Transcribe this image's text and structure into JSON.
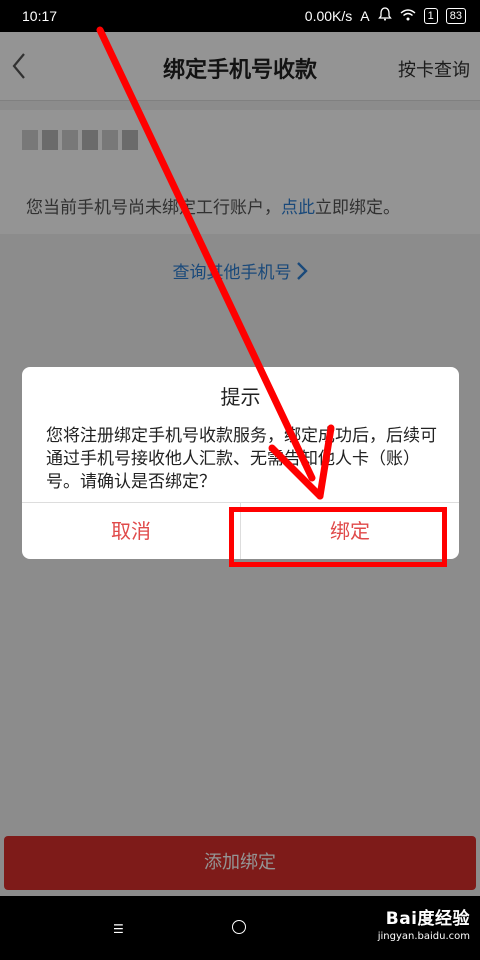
{
  "status_bar": {
    "time": "10:17",
    "network_speed": "0.00K/s",
    "sim": "1",
    "battery": "83"
  },
  "header": {
    "title": "绑定手机号收款",
    "right_link": "按卡查询"
  },
  "content": {
    "notice_prefix": "您当前手机号尚未绑定工行账户，",
    "notice_link": "点此",
    "notice_suffix": "立即绑定。",
    "query_other": "查询其他手机号"
  },
  "bottom_button": {
    "label": "添加绑定"
  },
  "dialog": {
    "title": "提示",
    "message": "您将注册绑定手机号收款服务，绑定成功后，后续可通过手机号接收他人汇款、无需告知他人卡（账）号。请确认是否绑定？",
    "cancel_label": "取消",
    "confirm_label": "绑定"
  },
  "watermark": {
    "logo": "Bai度经验",
    "url": "jingyan.baidu.com"
  },
  "colors": {
    "accent_blue": "#2d7fd3",
    "dialog_button_red": "#e04a4a",
    "primary_red": "#d9302b",
    "annotation_red": "#ff0000"
  }
}
